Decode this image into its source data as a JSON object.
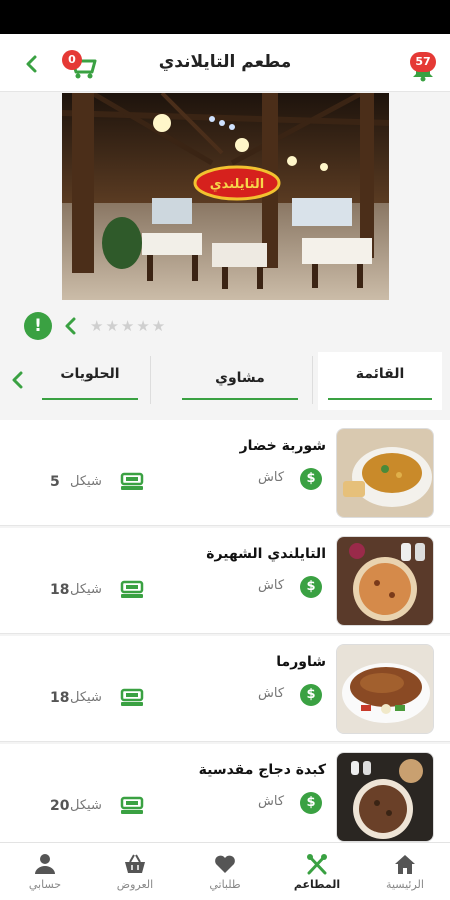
{
  "header": {
    "title": "مطعم التايلاندي",
    "cart_count": "0",
    "notification_count": "57"
  },
  "hero": {
    "logo_text": "التايلندي"
  },
  "rating": {
    "stars": "★★★★★",
    "info_symbol": "!"
  },
  "tabs": [
    {
      "label": "القائمة",
      "active": true
    },
    {
      "label": "مشاوي",
      "active": false
    },
    {
      "label": "الحلويات",
      "active": false
    }
  ],
  "menu_items": [
    {
      "name": "شوربة خضار",
      "payment": "كاش",
      "payment_symbol": "$",
      "currency": "شيكل",
      "price": "5"
    },
    {
      "name": "التايلندي الشهيرة",
      "payment": "كاش",
      "payment_symbol": "$",
      "currency": "شيكل",
      "price": "18"
    },
    {
      "name": "شاورما",
      "payment": "كاش",
      "payment_symbol": "$",
      "currency": "شيكل",
      "price": "18"
    },
    {
      "name": "كبدة دجاج مقدسية",
      "payment": "كاش",
      "payment_symbol": "$",
      "currency": "شيكل",
      "price": "20"
    }
  ],
  "bottom_nav": [
    {
      "label": "الرئيسية",
      "icon": "home-icon",
      "active": false
    },
    {
      "label": "المطاعم",
      "icon": "utensils-icon",
      "active": true
    },
    {
      "label": "طلباتي",
      "icon": "heart-icon",
      "active": false
    },
    {
      "label": "العروض",
      "icon": "basket-icon",
      "active": false
    },
    {
      "label": "حسابي",
      "icon": "user-icon",
      "active": false
    }
  ],
  "colors": {
    "accent": "#3aa142",
    "badge": "#e53935"
  }
}
